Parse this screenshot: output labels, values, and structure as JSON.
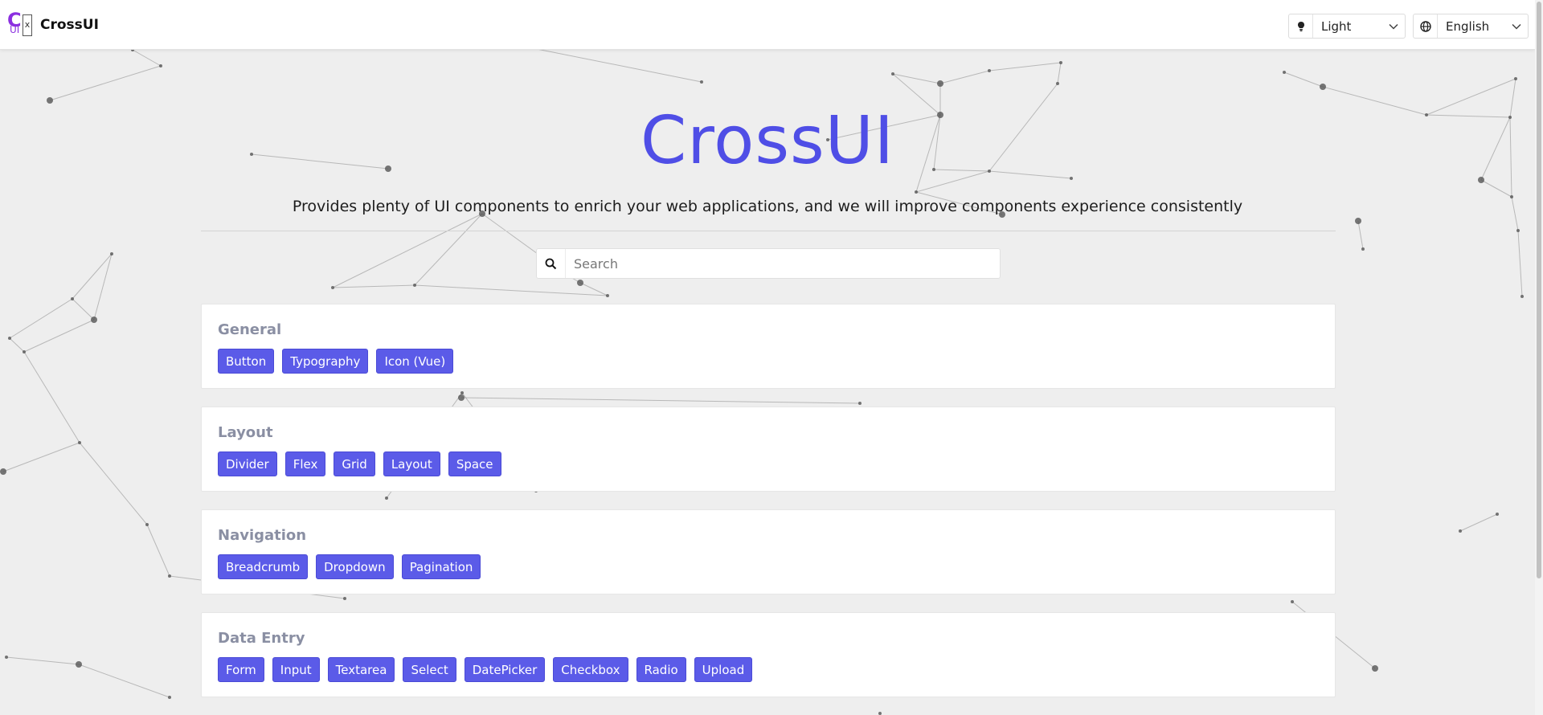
{
  "header": {
    "brand_name": "CrossUI",
    "logo_letter": "C",
    "logo_sub": "UI",
    "logo_mark": "x",
    "theme_select": {
      "value": "Light",
      "icon": "bulb-icon"
    },
    "language_select": {
      "value": "English",
      "icon": "globe-icon"
    }
  },
  "hero": {
    "title": "CrossUI",
    "subtitle": "Provides plenty of UI components to enrich your web applications, and we will improve components experience consistently"
  },
  "search": {
    "placeholder": "Search",
    "value": ""
  },
  "sections": [
    {
      "title": "General",
      "items": [
        "Button",
        "Typography",
        "Icon (Vue)"
      ]
    },
    {
      "title": "Layout",
      "items": [
        "Divider",
        "Flex",
        "Grid",
        "Layout",
        "Space"
      ]
    },
    {
      "title": "Navigation",
      "items": [
        "Breadcrumb",
        "Dropdown",
        "Pagination"
      ]
    },
    {
      "title": "Data Entry",
      "items": [
        "Form",
        "Input",
        "Textarea",
        "Select",
        "DatePicker",
        "Checkbox",
        "Radio",
        "Upload"
      ]
    }
  ],
  "colors": {
    "accent": "#4f4ee6",
    "tag_background": "#5b5be8",
    "section_title": "#8a8fa3",
    "page_background": "#eeeeee"
  }
}
